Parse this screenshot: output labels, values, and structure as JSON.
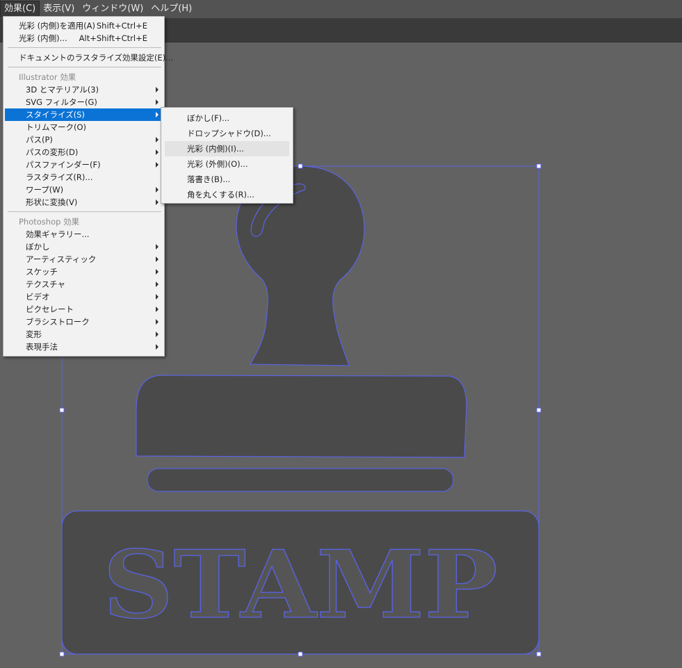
{
  "menubar": {
    "items": [
      "効果(C)",
      "表示(V)",
      "ウィンドウ(W)",
      "ヘルプ(H)"
    ]
  },
  "effect_menu": {
    "apply_last": {
      "label": "光彩 (内側)を適用(A)",
      "shortcut": "Shift+Ctrl+E"
    },
    "last_effect": {
      "label": "光彩 (内側)...",
      "shortcut": "Alt+Shift+Ctrl+E"
    },
    "raster_settings": "ドキュメントのラスタライズ効果設定(E)...",
    "illustrator_header": "Illustrator 効果",
    "illustrator_items": [
      "3D とマテリアル(3)",
      "SVG フィルター(G)",
      "スタイライズ(S)",
      "トリムマーク(O)",
      "パス(P)",
      "パスの変形(D)",
      "パスファインダー(F)",
      "ラスタライズ(R)...",
      "ワープ(W)",
      "形状に変換(V)"
    ],
    "photoshop_header": "Photoshop 効果",
    "photoshop_items": [
      "効果ギャラリー...",
      "ぼかし",
      "アーティスティック",
      "スケッチ",
      "テクスチャ",
      "ビデオ",
      "ピクセレート",
      "ブラシストローク",
      "変形",
      "表現手法"
    ]
  },
  "stylize_submenu": {
    "items": [
      "ぼかし(F)...",
      "ドロップシャドウ(D)...",
      "光彩 (内側)(I)...",
      "光彩 (外側)(O)...",
      "落書き(B)...",
      "角を丸くする(R)..."
    ]
  },
  "artwork": {
    "stamp_text": "STAMP",
    "fill_color": "#4a4a4a",
    "outline_color": "#5a63e6",
    "canvas_color": "#626262"
  }
}
